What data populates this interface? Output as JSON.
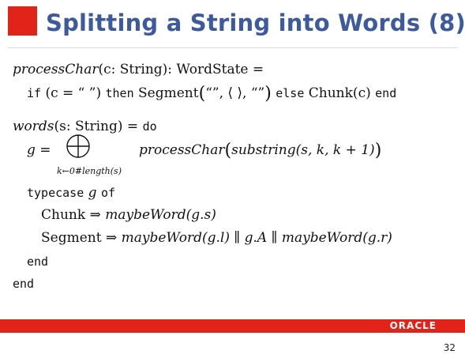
{
  "slide": {
    "title": "Splitting a String into Words (8)",
    "page_number": "32"
  },
  "footer": {
    "logo_text": "ORACLE",
    "brand_color": "#e2231a"
  },
  "code": {
    "l1": {
      "fn": "processChar",
      "rest": "(c: String): WordState ="
    },
    "l2": {
      "kw_if": "if",
      "cond": "(c = “ ”)",
      "kw_then": "then",
      "seg": "Segment",
      "seg_args": "“”, ⟨ ⟩, “”",
      "kw_else": "else",
      "chunk": "Chunk(c)",
      "kw_end": "end"
    },
    "l3": {
      "fn": "words",
      "rest": "(s: String) =",
      "kw_do": "do"
    },
    "l4": {
      "lhs": "g =",
      "fn": "processChar",
      "arg": "substring(s, k, k + 1)",
      "subscript": "k←0#length(s)"
    },
    "l5": {
      "kw": "typecase",
      "var": "g",
      "kw_of": "of"
    },
    "l6": {
      "ctor": "Chunk",
      "arrow": "⇒",
      "expr": "maybeWord(g.s)"
    },
    "l7": {
      "ctor": "Segment",
      "arrow": "⇒",
      "expr": "maybeWord(g.l) ∥ g.A ∥ maybeWord(g.r)"
    },
    "l8": {
      "kw": "end"
    },
    "l9": {
      "kw": "end"
    }
  }
}
